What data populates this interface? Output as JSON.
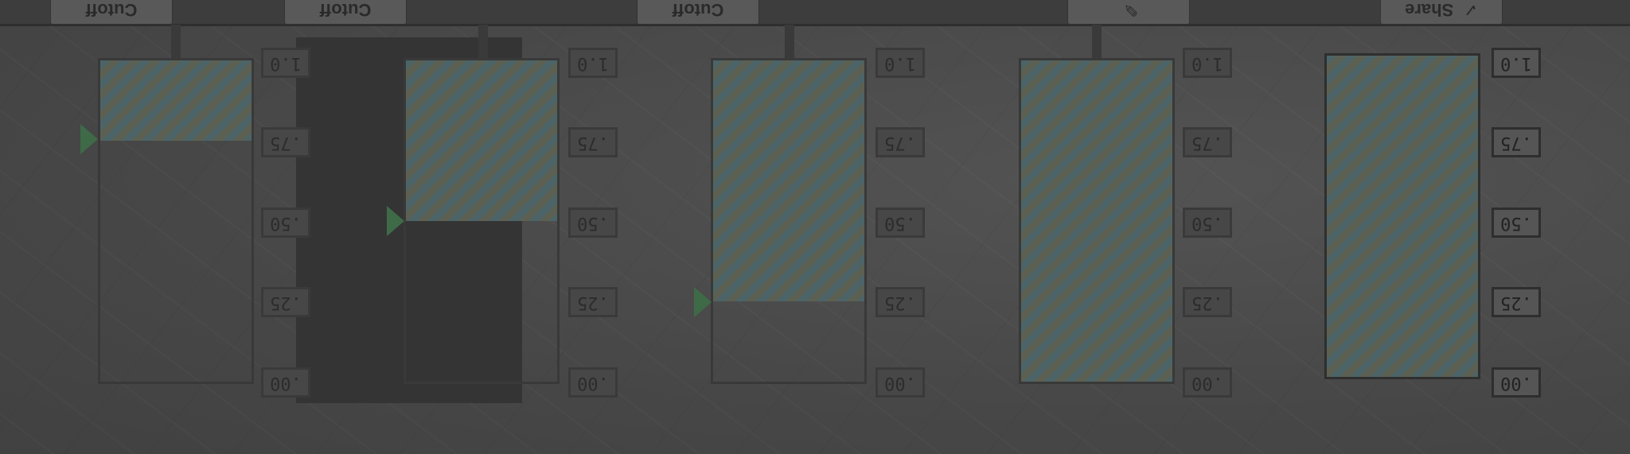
{
  "toolbar": {
    "cutoff_buttons": [
      "Cutoff",
      "Cutoff",
      "Cutoff"
    ],
    "button_4": {
      "label": "",
      "icon": "pencil-icon"
    },
    "button_5": {
      "label": "Share",
      "icon": "check-icon"
    }
  },
  "gauges": [
    {
      "name": "gauge-1",
      "level": 0.25,
      "marker": 0.25,
      "selected": false
    },
    {
      "name": "gauge-2",
      "level": 0.5,
      "marker": 0.5,
      "selected": false
    },
    {
      "name": "gauge-3",
      "level": 0.75,
      "marker": 0.75,
      "selected": false
    },
    {
      "name": "gauge-4",
      "level": 1.0,
      "marker": null,
      "selected": false
    },
    {
      "name": "gauge-5",
      "level": 1.0,
      "marker": null,
      "selected": true
    }
  ],
  "scale_labels": [
    "1.0",
    ".75",
    ".50",
    ".25",
    ".00"
  ],
  "colors": {
    "fill_stripe_a": "#4c6467",
    "fill_stripe_b": "#5c6052",
    "marker": "#3f6a48"
  }
}
